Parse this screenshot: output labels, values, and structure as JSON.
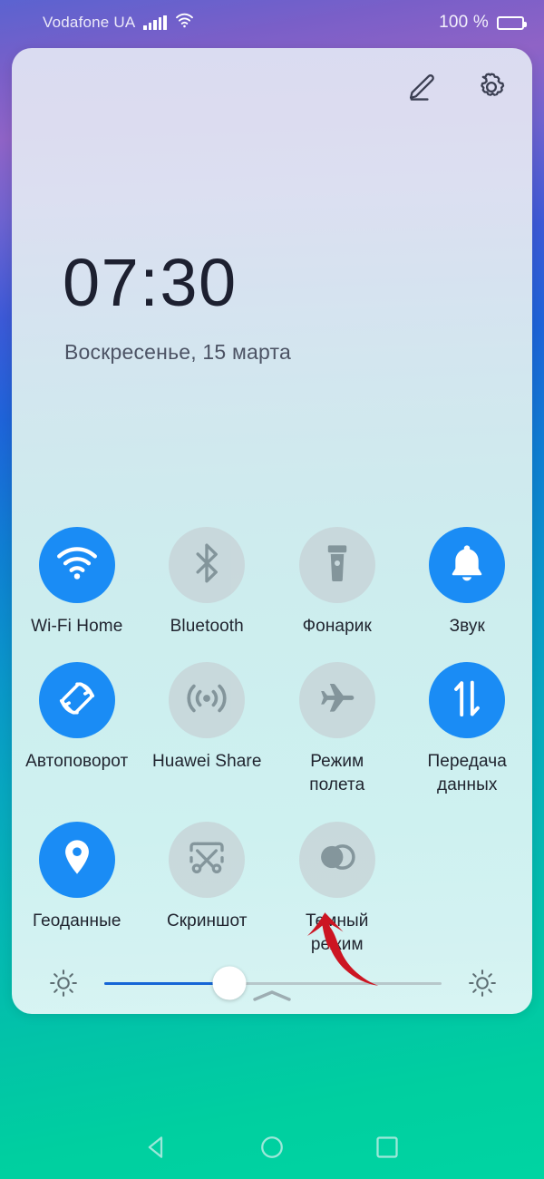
{
  "statusbar": {
    "carrier": "Vodafone UA",
    "signal_icon": "signal-bars-icon",
    "wifi_icon": "wifi-icon",
    "battery_percent": "100 %",
    "battery_icon": "battery-full-icon"
  },
  "panel": {
    "edit_label": "edit-icon",
    "settings_label": "gear-icon",
    "clock": "07:30",
    "date": "Воскресенье, 15 марта",
    "collapse_handle": "chevron-up-icon"
  },
  "toggles": [
    {
      "label": "Wi-Fi Home",
      "icon": "wifi-icon",
      "state": "on"
    },
    {
      "label": "Bluetooth",
      "icon": "bluetooth-icon",
      "state": "off"
    },
    {
      "label": "Фонарик",
      "icon": "flashlight-icon",
      "state": "off"
    },
    {
      "label": "Звук",
      "icon": "bell-icon",
      "state": "on"
    },
    {
      "label": "Автоповорот",
      "icon": "auto-rotate-icon",
      "state": "on"
    },
    {
      "label": "Huawei Share",
      "icon": "broadcast-icon",
      "state": "off"
    },
    {
      "label": "Режим\nполета",
      "icon": "airplane-icon",
      "state": "off"
    },
    {
      "label": "Передача\nданных",
      "icon": "data-transfer-icon",
      "state": "on"
    },
    {
      "label": "Геоданные",
      "icon": "location-pin-icon",
      "state": "on"
    },
    {
      "label": "Скриншот",
      "icon": "screenshot-icon",
      "state": "off"
    },
    {
      "label": "Темный\nрежим",
      "icon": "dark-mode-icon",
      "state": "off"
    }
  ],
  "brightness": {
    "low_icon": "brightness-low-icon",
    "high_icon": "brightness-high-icon",
    "value_percent": 37
  },
  "annotation": {
    "type": "red-arrow",
    "points_to": "Темный режим",
    "color": "#cc1522"
  },
  "navbar": {
    "back": "back-triangle-icon",
    "home": "home-circle-icon",
    "recents": "recents-square-icon"
  },
  "colors": {
    "accent_on": "#1a8cf5",
    "toggle_off": "#c7d2d6",
    "slider_fill": "#1566d6",
    "annotation_red": "#cc1522"
  }
}
